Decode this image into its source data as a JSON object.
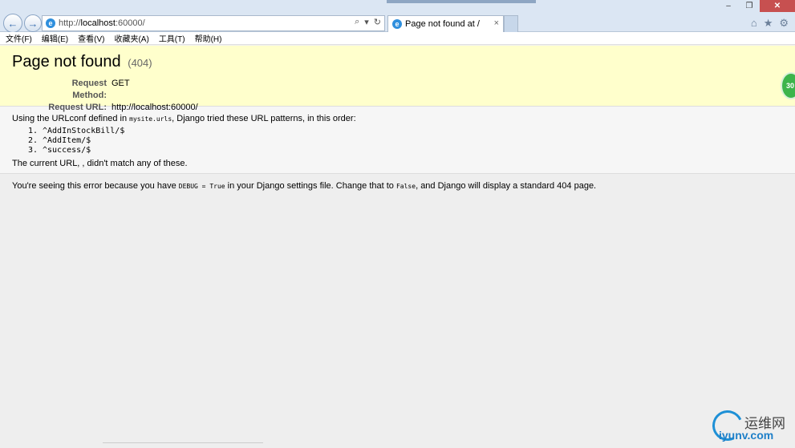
{
  "browser": {
    "url_prefix": "http://",
    "url_host": "localhost",
    "url_suffix": ":60000/",
    "tab_title": "Page not found at /",
    "tab_close": "×",
    "back_glyph": "←",
    "forward_glyph": "→",
    "search_glyph": "⌕",
    "dropdown_glyph": "▾",
    "refresh_glyph": "↻",
    "home_glyph": "⌂",
    "favorites_glyph": "★",
    "tools_glyph": "⚙",
    "minimize_glyph": "–",
    "restore_glyph": "❐",
    "close_glyph": "✕",
    "icons": [
      "back-icon",
      "forward-icon",
      "ie-icon",
      "search-icon",
      "refresh-icon",
      "home-icon",
      "star-icon",
      "gear-icon"
    ]
  },
  "menu": {
    "items": [
      "文件(F)",
      "编辑(E)",
      "查看(V)",
      "收藏夹(A)",
      "工具(T)",
      "帮助(H)"
    ]
  },
  "page": {
    "title": "Page not found",
    "status": "(404)",
    "request_method_label": "Request Method:",
    "request_method": "GET",
    "request_url_label": "Request URL:",
    "request_url": "http://localhost:60000/",
    "urlconf_intro_before": "Using the URLconf defined in ",
    "urlconf_module": "mysite.urls",
    "urlconf_intro_after": ", Django tried these URL patterns, in this order:",
    "patterns": [
      "^AddInStockBill/$",
      "^AddItem/$",
      "^success/$"
    ],
    "no_match": "The current URL, , didn't match any of these.",
    "explain_1": "You're seeing this error because you have ",
    "explain_code1": "DEBUG = True",
    "explain_2": " in your Django settings file. Change that to ",
    "explain_code2": "False",
    "explain_3": ", and Django will display a standard 404 page."
  },
  "overlay": {
    "badge": "30",
    "watermark_top": "运维网",
    "watermark_bottom": "iyunv.com"
  },
  "colors": {
    "summary_bg": "#ffffcc",
    "page_bg": "#eeeeee",
    "chrome_bg": "#dbe6f3",
    "close_btn": "#c75050"
  }
}
